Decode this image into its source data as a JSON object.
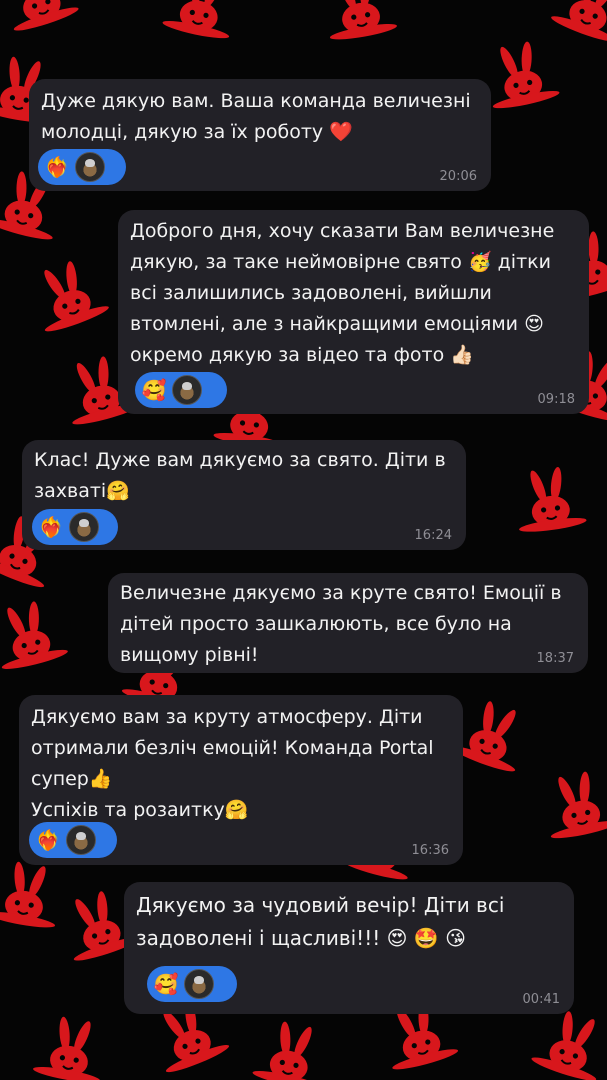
{
  "messages": [
    {
      "text": "Дуже дякую вам. Ваша команда величезні молодці, дякую за їх роботу ❤️",
      "time": "20:06",
      "reaction": "❤️‍🔥"
    },
    {
      "text": "Доброго дня, хочу сказати Вам величезне дякую, за таке неймовірне свято 🥳 дітки всі залишились задоволені, вийшли втомлені, але з найкращими емоціями 😍 окремо дякую за відео та фото 👍🏻",
      "time": "09:18",
      "reaction": "🥰"
    },
    {
      "text": "Клас! Дуже вам дякуємо за свято. Діти в захваті🤗",
      "time": "16:24",
      "reaction": "❤️‍🔥"
    },
    {
      "text": "Величезне дякуємо за круте свято! Емоції в дітей просто зашкалюють, все було на вищому рівні!",
      "time": "18:37",
      "reaction": ""
    },
    {
      "text_lines": [
        "Дякуємо вам за круту атмосферу. Діти отримали безліч емоцій! Команда Portal супер👍",
        "Успіхів та розаитку🤗"
      ],
      "time": "16:36",
      "reaction": "❤️‍🔥"
    },
    {
      "text": "Дякуємо за чудовий вечір! Діти всі задоволені і щасливі!!! 😍 🤩 😘",
      "time": "00:41",
      "reaction": "🥰"
    }
  ],
  "colors": {
    "background": "#050505",
    "wallpaper_pattern": "#d8171c",
    "bubble": "#222127",
    "reaction_pill": "#2e77e5",
    "timestamp": "#8f8e95"
  },
  "icons": {
    "wallpaper": "bunny-pattern",
    "reaction_avatar": "user-avatar"
  }
}
